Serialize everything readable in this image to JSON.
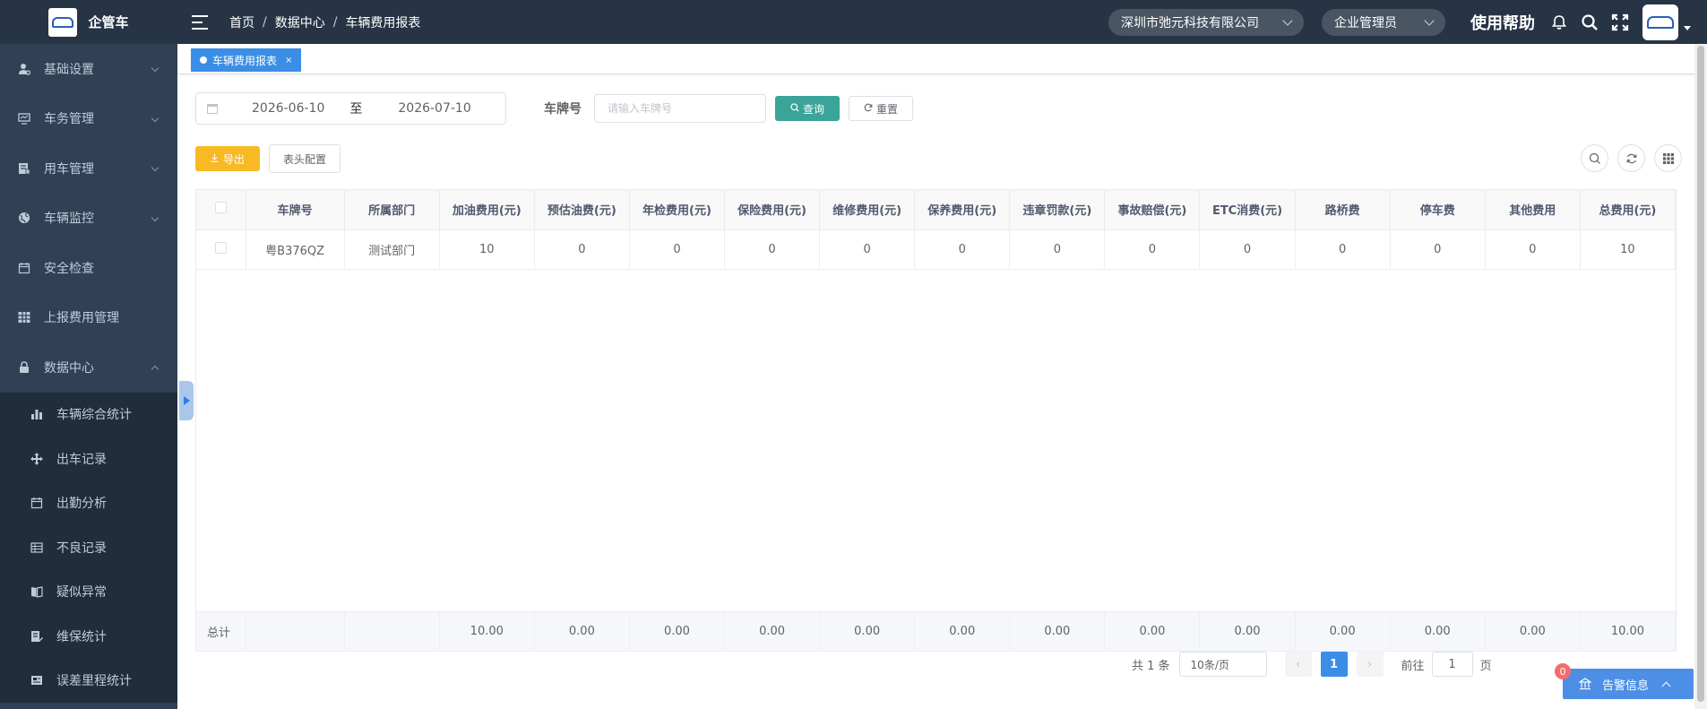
{
  "app": {
    "name": "企管车"
  },
  "header": {
    "breadcrumb": [
      "首页",
      "数据中心",
      "车辆费用报表"
    ],
    "company": "深圳市弛元科技有限公司",
    "role": "企业管理员",
    "help": "使用帮助"
  },
  "sidebar": {
    "items": [
      {
        "label": "基础设置",
        "icon": "user-gear-icon",
        "expanded": false
      },
      {
        "label": "车务管理",
        "icon": "monitor-icon",
        "expanded": false
      },
      {
        "label": "用车管理",
        "icon": "document-icon",
        "expanded": false
      },
      {
        "label": "车辆监控",
        "icon": "globe-icon",
        "expanded": false
      },
      {
        "label": "安全检查",
        "icon": "calendar-icon"
      },
      {
        "label": "上报费用管理",
        "icon": "grid-icon"
      },
      {
        "label": "数据中心",
        "icon": "lock-icon",
        "expanded": true
      }
    ],
    "sub_items": [
      {
        "label": "车辆综合统计",
        "icon": "bar-chart-icon"
      },
      {
        "label": "出车记录",
        "icon": "move-icon"
      },
      {
        "label": "出勤分析",
        "icon": "calendar-icon"
      },
      {
        "label": "不良记录",
        "icon": "table-icon"
      },
      {
        "label": "疑似异常",
        "icon": "book-icon"
      },
      {
        "label": "维保统计",
        "icon": "edit-doc-icon"
      },
      {
        "label": "误差里程统计",
        "icon": "newspaper-icon"
      }
    ]
  },
  "tags": [
    {
      "label": "车辆费用报表",
      "close": "×"
    }
  ],
  "search": {
    "date_start": "2026-06-10",
    "date_to": "至",
    "date_end": "2026-07-10",
    "plate_label": "车牌号",
    "plate_placeholder": "请输入车牌号",
    "query_label": "查询",
    "reset_label": "重置"
  },
  "actions": {
    "export_label": "导出",
    "columns_label": "表头配置"
  },
  "table": {
    "columns": [
      "车牌号",
      "所属部门",
      "加油费用(元)",
      "预估油费(元)",
      "年检费用(元)",
      "保险费用(元)",
      "维修费用(元)",
      "保养费用(元)",
      "违章罚款(元)",
      "事故赔偿(元)",
      "ETC消费(元)",
      "路桥费",
      "停车费",
      "其他费用",
      "总费用(元)"
    ],
    "rows": [
      [
        "粤B376QZ",
        "测试部门",
        "10",
        "0",
        "0",
        "0",
        "0",
        "0",
        "0",
        "0",
        "0",
        "0",
        "0",
        "0",
        "10"
      ]
    ],
    "summary_label": "总计",
    "summary": [
      "",
      "",
      "10.00",
      "0.00",
      "0.00",
      "0.00",
      "0.00",
      "0.00",
      "0.00",
      "0.00",
      "0.00",
      "0.00",
      "0.00",
      "0.00",
      "10.00"
    ]
  },
  "pagination": {
    "total": "共 1 条",
    "page_size": "10条/页",
    "current_page": "1",
    "goto_label": "前往",
    "goto_value": "1",
    "page_unit": "页"
  },
  "alarm": {
    "label": "告警信息",
    "count": "0"
  },
  "colors": {
    "header_bg": "#263445",
    "sidebar_bg": "#304156",
    "primary": "#3a8ee6",
    "query": "#3aa39a",
    "export": "#f7b924"
  }
}
